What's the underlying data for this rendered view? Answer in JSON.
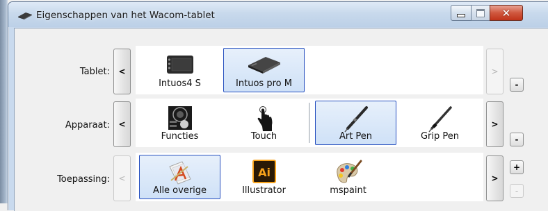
{
  "window": {
    "title": "Eigenschappen van het Wacom-tablet",
    "icon": "tablet-icon",
    "controls": {
      "minimize": "minimize-icon",
      "maximize": "maximize-icon",
      "close": "✕"
    }
  },
  "rows": {
    "tablet": {
      "label": "Tablet:",
      "items": [
        {
          "label": "Intuos4 S",
          "icon": "intuos4-tablet-icon",
          "selected": false
        },
        {
          "label": "Intuos pro M",
          "icon": "intuos-pro-tablet-icon",
          "selected": true
        }
      ],
      "prev": "<",
      "next": ">",
      "remove": "-"
    },
    "apparaat": {
      "label": "Apparaat:",
      "items": [
        {
          "label": "Functies",
          "icon": "functions-icon",
          "selected": false
        },
        {
          "label": "Touch",
          "icon": "touch-icon",
          "selected": false
        },
        {
          "label": "Art Pen",
          "icon": "art-pen-icon",
          "selected": true
        },
        {
          "label": "Grip Pen",
          "icon": "grip-pen-icon",
          "selected": false
        }
      ],
      "prev": "<",
      "next": ">",
      "remove": "-"
    },
    "toepassing": {
      "label": "Toepassing:",
      "items": [
        {
          "label": "Alle overige",
          "icon": "all-other-apps-icon",
          "selected": true
        },
        {
          "label": "Illustrator",
          "icon": "illustrator-icon",
          "selected": false,
          "icon_text": "Ai"
        },
        {
          "label": "mspaint",
          "icon": "mspaint-icon",
          "selected": false
        }
      ],
      "prev": "<",
      "next": ">",
      "add": "+",
      "remove": "-"
    }
  },
  "colors": {
    "selection_border": "#264fbf",
    "selection_fill": "#cfe1f7",
    "titlebar": "#c8d9ec",
    "close_button": "#c0341a",
    "illustrator_bg": "#2a1a06",
    "illustrator_accent": "#f7a21b"
  }
}
